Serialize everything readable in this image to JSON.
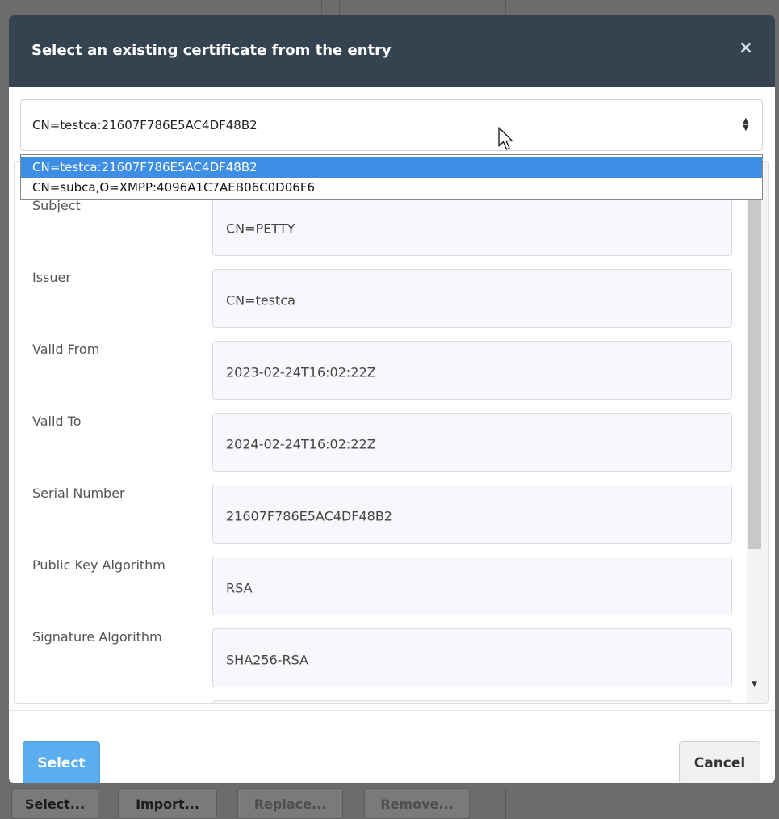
{
  "background": {
    "buttons": [
      "Select...",
      "Import...",
      "Replace...",
      "Remove..."
    ]
  },
  "dialog": {
    "title": "Select an existing certificate from the entry",
    "close_glyph": "×",
    "certificate_select": {
      "value": "CN=testca:21607F786E5AC4DF48B2",
      "options": [
        {
          "label": "CN=testca:21607F786E5AC4DF48B2",
          "selected": true
        },
        {
          "label": "CN=subca,O=XMPP:4096A1C7AEB06C0D06F6",
          "selected": false
        }
      ]
    },
    "fields": [
      {
        "label": "Subject",
        "value": "CN=PETTY"
      },
      {
        "label": "Issuer",
        "value": "CN=testca"
      },
      {
        "label": "Valid From",
        "value": "2023-02-24T16:02:22Z"
      },
      {
        "label": "Valid To",
        "value": "2024-02-24T16:02:22Z"
      },
      {
        "label": "Serial Number",
        "value": "21607F786E5AC4DF48B2"
      },
      {
        "label": "Public Key Algorithm",
        "value": "RSA"
      },
      {
        "label": "Signature Algorithm",
        "value": "SHA256-RSA"
      },
      {
        "label": "",
        "value": ""
      }
    ],
    "footer": {
      "select_label": "Select",
      "cancel_label": "Cancel"
    }
  },
  "colors": {
    "header_bg": "#34434f",
    "primary_button": "#5aaef0",
    "selected_option": "#3d8ee4"
  },
  "icons": {
    "close": "close-icon",
    "select_arrows": "updown-arrows-icon",
    "cursor": "mouse-pointer-icon"
  }
}
